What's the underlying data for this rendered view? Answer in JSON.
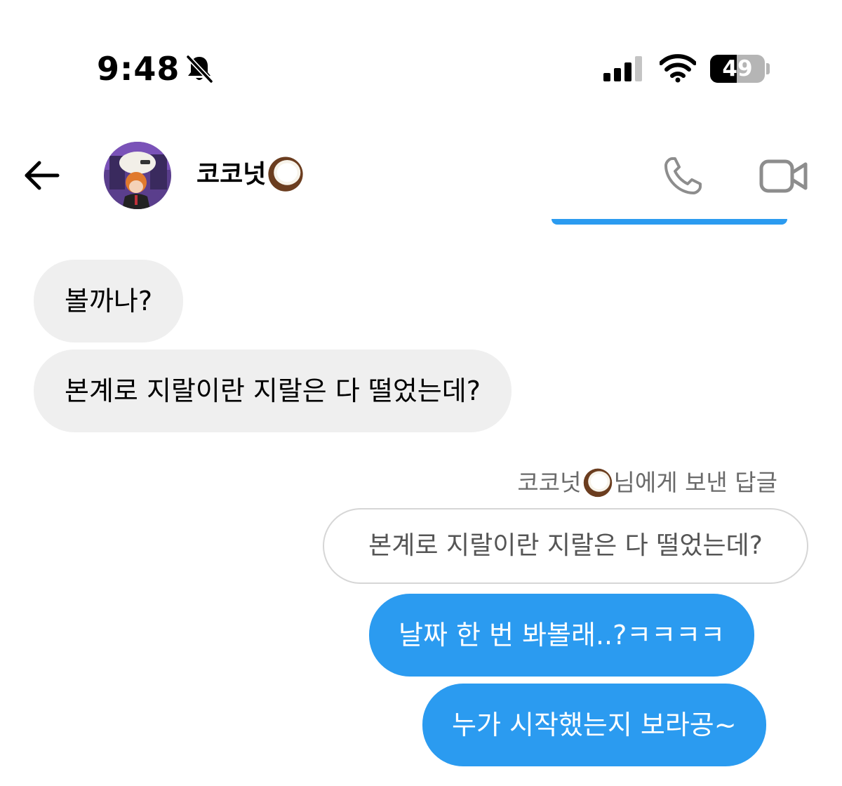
{
  "status_bar": {
    "time": "9:48",
    "battery_level": "49",
    "battery_fraction": 0.49,
    "icons": [
      "bell-slash-icon",
      "cellular-signal-icon",
      "wifi-icon",
      "battery-icon"
    ]
  },
  "header": {
    "contact_name": "코코넛",
    "name_emoji": "coconut-emoji",
    "icons": [
      "back-arrow-icon",
      "phone-icon",
      "video-call-icon"
    ]
  },
  "messages": {
    "incoming": [
      "볼까나?",
      "본계로 지랄이란 지랄은 다 떨었는데?"
    ],
    "reply_caption": {
      "name": "코코넛",
      "suffix": "님에게 보낸 답글"
    },
    "reply_quote": "본계로 지랄이란 지랄은 다 떨었는데?",
    "outgoing": [
      "날짜 한 번 봐볼래..?ㅋㅋㅋㅋ",
      "누가 시작했는지 보라공~"
    ]
  },
  "colors": {
    "accent": "#2b9bf0",
    "incoming_bubble": "#efefef",
    "caption_text": "#6a6a6a"
  }
}
